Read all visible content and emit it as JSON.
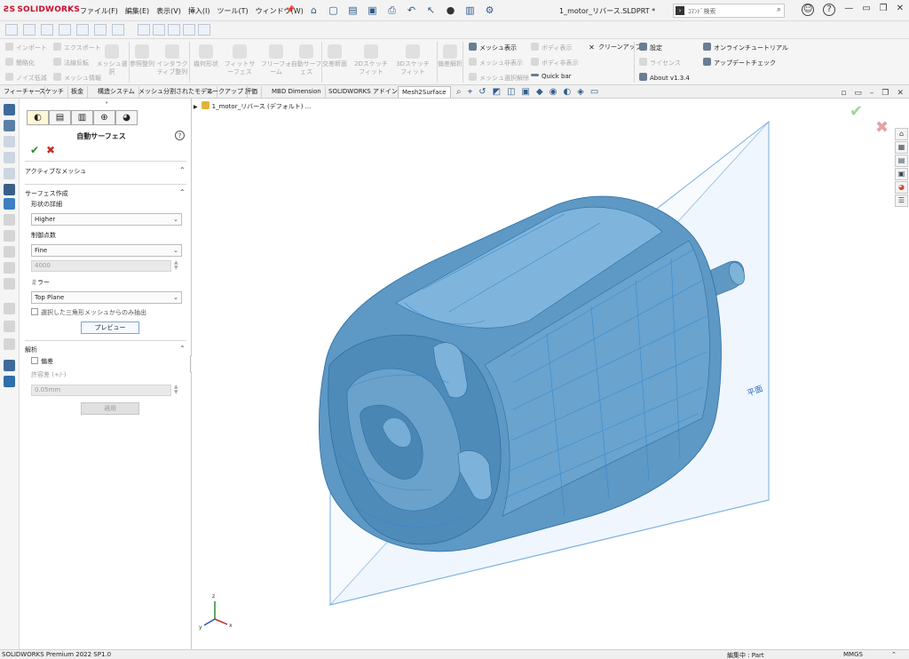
{
  "app": {
    "logo_text": "SOLIDWORKS",
    "menu": [
      "ファイル(F)",
      "編集(E)",
      "表示(V)",
      "挿入(I)",
      "ツール(T)",
      "ウィンドウ(W)"
    ],
    "doc_title": "1_motor_リバース.SLDPRT *",
    "search_placeholder": "ｺﾏﾝﾄﾞ検索"
  },
  "ribbon": {
    "mesh_tools": [
      {
        "label": "インポート",
        "enabled": false
      },
      {
        "label": "エクスポート",
        "enabled": false
      },
      {
        "label": "簡略化",
        "enabled": false
      },
      {
        "label": "法線反転",
        "enabled": false
      },
      {
        "label": "ノイズ低減",
        "enabled": false
      },
      {
        "label": "メッシュ情報",
        "enabled": false
      }
    ],
    "big_buttons": [
      {
        "label": "メッシュ選択"
      },
      {
        "label": "参照整列"
      },
      {
        "label": "インタラクティブ整列"
      },
      {
        "label": "幾何形状"
      },
      {
        "label": "フィットサーフェス"
      },
      {
        "label": "フリーフォーム"
      },
      {
        "label": "自動サーフェス"
      },
      {
        "label": "交差断面"
      },
      {
        "label": "2Dスケッチフィット"
      },
      {
        "label": "3Dスケッチフィット"
      },
      {
        "label": "偏差解析"
      }
    ],
    "display_tools": [
      {
        "label": "メッシュ表示",
        "enabled": true
      },
      {
        "label": "ボディ表示",
        "enabled": false
      },
      {
        "label": "クリーンアップ",
        "enabled": true
      },
      {
        "label": "メッシュ非表示",
        "enabled": false
      },
      {
        "label": "ボディ非表示",
        "enabled": false
      },
      {
        "label": "メッシュ選択解除",
        "enabled": false
      },
      {
        "label": "Quick bar",
        "enabled": true
      }
    ],
    "settings_tools": [
      {
        "label": "設定",
        "enabled": true
      },
      {
        "label": "オンラインチュートリアル",
        "enabled": true
      },
      {
        "label": "ライセンス",
        "enabled": false
      },
      {
        "label": "アップデートチェック",
        "enabled": true
      },
      {
        "label": "About v1.3.4",
        "enabled": true
      }
    ]
  },
  "tabs": [
    "フィーチャー",
    "スケッチ",
    "板金",
    "構造システム",
    "メッシュ分割されたモデル",
    "マークアップ",
    "評価",
    "MBD Dimension",
    "SOLIDWORKS アドイン",
    "Mesh2Surface"
  ],
  "active_tab": "Mesh2Surface",
  "panel": {
    "title": "自動サーフェス",
    "help": "?",
    "sections": {
      "active_mesh": "アクティブなメッシュ",
      "surface_creation": "サーフェス作成",
      "analysis": "解析"
    },
    "shape_detail_label": "形状の詳細",
    "shape_detail_value": "Higher",
    "control_points_label": "制御点数",
    "control_points_value": "Fine",
    "control_points_number": "4000",
    "mirror_label": "ミラー",
    "mirror_value": "Top Plane",
    "only_selected_label": "選択した三角形メッシュからのみ抽出",
    "preview_button": "プレビュー",
    "deviation_label": "偏差",
    "tolerance_label": "許容差 (+/-)",
    "tolerance_value": "0.05mm",
    "apply_button": "適用"
  },
  "viewport": {
    "breadcrumb": "1_motor_リバース (デフォルト) ...",
    "plane_label": "平面",
    "triad": {
      "x": "x",
      "y": "y",
      "z": "z"
    }
  },
  "status": {
    "product": "SOLIDWORKS Premium 2022 SP1.0",
    "editing": "編集中 : Part",
    "units": "MMGS"
  }
}
